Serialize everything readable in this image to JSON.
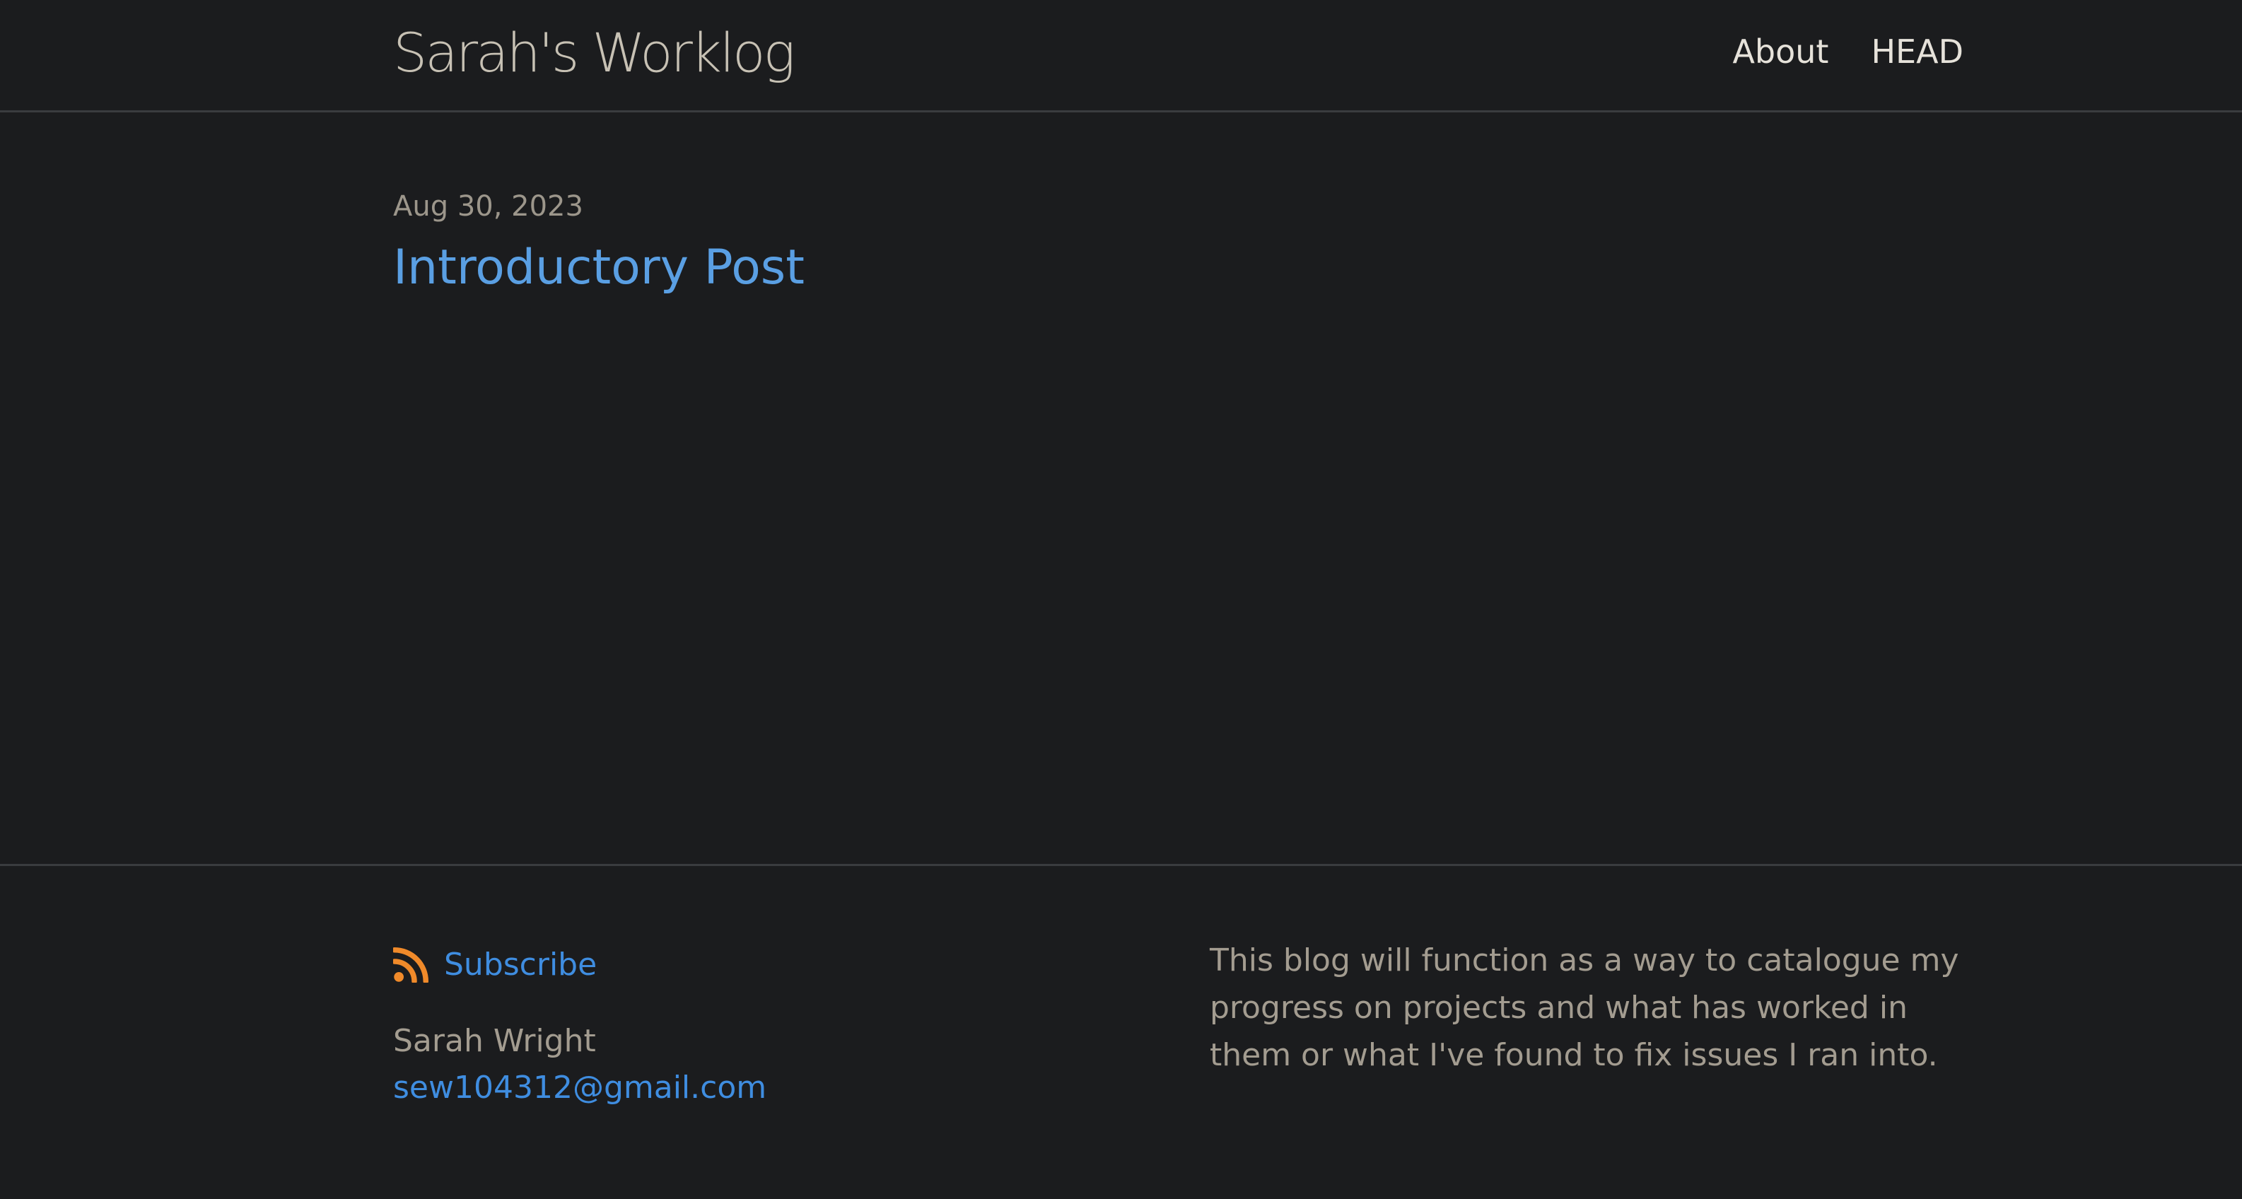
{
  "header": {
    "site_title": "Sarah's Worklog",
    "nav": [
      {
        "label": "About"
      },
      {
        "label": "HEAD"
      }
    ]
  },
  "main": {
    "posts": [
      {
        "date": "Aug 30, 2023",
        "title": "Introductory Post"
      }
    ]
  },
  "footer": {
    "subscribe_label": "Subscribe",
    "author_name": "Sarah Wright",
    "author_email": "sew104312@gmail.com",
    "description": "This blog will function as a way to catalogue my progress on projects and what has worked in them or what I've found to fix issues I ran into."
  },
  "colors": {
    "background": "#1b1c1e",
    "link": "#3f8de0",
    "post_title": "#5a9fe3",
    "text": "#a39c90",
    "rss": "#f08a2a"
  },
  "icons": {
    "subscribe": "rss-icon"
  }
}
